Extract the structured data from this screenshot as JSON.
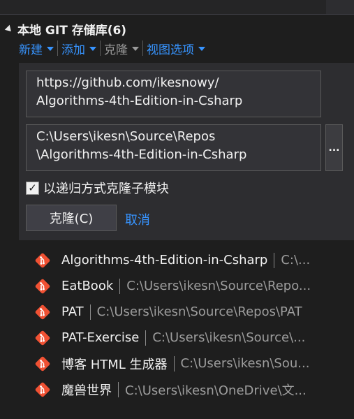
{
  "header": {
    "title": "本地 GIT 存储库(6)"
  },
  "toolbar": {
    "new_label": "新建",
    "add_label": "添加",
    "clone_label": "克隆",
    "view_options_label": "视图选项"
  },
  "clone_panel": {
    "url_value": "https://github.com/ikesnowy/\nAlgorithms-4th-Edition-in-Csharp",
    "path_value": "C:\\Users\\ikesn\\Source\\Repos\n\\Algorithms-4th-Edition-in-Csharp",
    "browse_label": "...",
    "recursive_checkbox_label": "以递归方式克隆子模块",
    "recursive_checked": true,
    "clone_button_label": "克隆(C)",
    "cancel_label": "取消"
  },
  "repositories": [
    {
      "name": "Algorithms-4th-Edition-in-Csharp",
      "path": "C:\\..."
    },
    {
      "name": "EatBook",
      "path": "C:\\Users\\ikesn\\Source\\Repo..."
    },
    {
      "name": "PAT",
      "path": "C:\\Users\\ikesn\\Source\\Repos\\PAT"
    },
    {
      "name": "PAT-Exercise",
      "path": "C:\\Users\\ikesn\\Source\\..."
    },
    {
      "name": "博客 HTML 生成器",
      "path": "C:\\Users\\ikesn\\Sou..."
    },
    {
      "name": "魔兽世界",
      "path": "C:\\Users\\ikesn\\OneDrive\\文..."
    }
  ],
  "colors": {
    "link": "#3794ff",
    "git_icon": "#f05133",
    "background": "#1e1e1e"
  },
  "icons": {
    "repo": "git-icon",
    "collapse": "collapse-triangle-icon",
    "dropdown": "chevron-down-icon"
  }
}
